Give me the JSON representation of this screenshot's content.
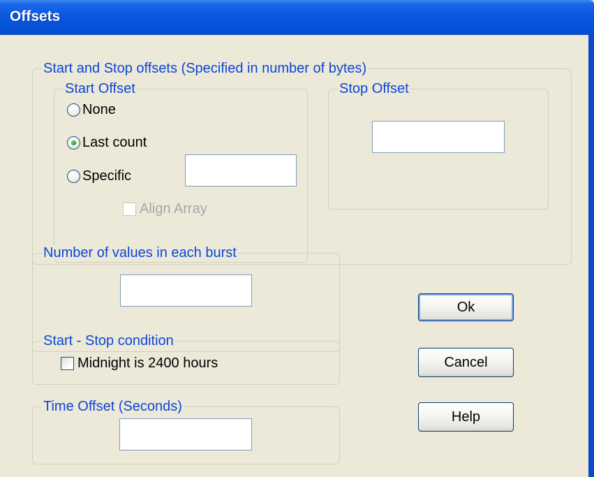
{
  "window": {
    "title": "Offsets"
  },
  "start_stop_group": {
    "label": "Start and Stop offsets (Specified in number of bytes)",
    "start_offset": {
      "label": "Start Offset",
      "options": [
        {
          "label": "None",
          "selected": false
        },
        {
          "label": "Last count",
          "selected": true
        },
        {
          "label": "Specific",
          "selected": false
        }
      ],
      "specific_value": "",
      "align_array": {
        "label": "Align Array",
        "checked": false,
        "enabled": false
      }
    },
    "stop_offset": {
      "label": "Stop Offset",
      "value": ""
    }
  },
  "burst_group": {
    "label": "Number of values in each burst",
    "value": ""
  },
  "condition_group": {
    "label": "Start - Stop condition",
    "midnight": {
      "label": "Midnight is 2400 hours",
      "checked": false
    }
  },
  "time_offset_group": {
    "label": "Time Offset (Seconds)",
    "value": ""
  },
  "buttons": {
    "ok": "Ok",
    "cancel": "Cancel",
    "help": "Help"
  },
  "colors": {
    "titlebar": "#0a58e0",
    "group_label": "#0b46d8",
    "dialog_bg": "#ece9d8",
    "radio_selected": "#21a121"
  }
}
